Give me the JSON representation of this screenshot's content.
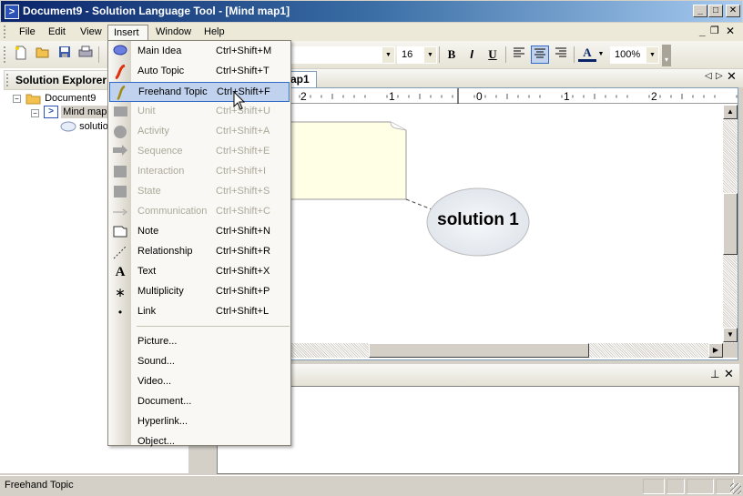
{
  "window": {
    "title": "Document9 - Solution Language Tool - [Mind map1]",
    "app_icon": "app-logo-icon",
    "controls": {
      "minimize": "_",
      "maximize": "□",
      "close": "✕"
    },
    "mdi_controls": {
      "minimize": "_",
      "restore": "🗗",
      "close": "✕"
    }
  },
  "menubar": {
    "items": [
      {
        "label": "File",
        "accel": "F"
      },
      {
        "label": "Edit",
        "accel": "E"
      },
      {
        "label": "View",
        "accel": "V"
      },
      {
        "label": "Insert",
        "accel": "I",
        "open": true
      },
      {
        "label": "Window",
        "accel": "W"
      },
      {
        "label": "Help",
        "accel": "H"
      }
    ]
  },
  "toolbar": {
    "buttons": [
      "new-icon",
      "open-icon",
      "save-icon",
      "print-icon"
    ],
    "font_name": "",
    "font_size": "16",
    "bold": "B",
    "italic": "I",
    "underline": "U",
    "align": [
      "left",
      "center",
      "right"
    ],
    "align_active": "center",
    "font_color_label": "A",
    "zoom": "100%"
  },
  "solution_explorer": {
    "title": "Solution Explorer",
    "tree": [
      {
        "label": "Document9",
        "icon": "folder-icon",
        "level": 0,
        "expanded": true
      },
      {
        "label": "Mind map1",
        "icon": "mindmap-icon",
        "level": 1,
        "expanded": true,
        "selected": true
      },
      {
        "label": "solution 1",
        "icon": "ellipse-icon",
        "level": 2
      }
    ]
  },
  "document": {
    "tab_label": "Mind map1",
    "tab_visible_text": "ap1",
    "ruler_labels": [
      "2",
      "1",
      "0",
      "1",
      "2"
    ],
    "canvas": {
      "note_fill": "#ffffe6",
      "node": {
        "label": "solution 1"
      }
    }
  },
  "insert_menu": {
    "items": [
      {
        "label": "Main Idea",
        "shortcut": "Ctrl+Shift+M",
        "icon": "ellipse-icon",
        "enabled": true
      },
      {
        "label": "Auto Topic",
        "shortcut": "Ctrl+Shift+T",
        "icon": "auto-topic-icon",
        "enabled": true
      },
      {
        "label": "Freehand Topic",
        "shortcut": "Ctrl+Shift+F",
        "icon": "freehand-topic-icon",
        "enabled": true,
        "highlighted": true
      },
      {
        "label": "Unit",
        "shortcut": "Ctrl+Shift+U",
        "icon": "unit-icon",
        "enabled": false
      },
      {
        "label": "Activity",
        "shortcut": "Ctrl+Shift+A",
        "icon": "activity-icon",
        "enabled": false
      },
      {
        "label": "Sequence",
        "shortcut": "Ctrl+Shift+E",
        "icon": "sequence-icon",
        "enabled": false
      },
      {
        "label": "Interaction",
        "shortcut": "Ctrl+Shift+I",
        "icon": "interaction-icon",
        "enabled": false
      },
      {
        "label": "State",
        "shortcut": "Ctrl+Shift+S",
        "icon": "state-icon",
        "enabled": false
      },
      {
        "label": "Communication",
        "shortcut": "Ctrl+Shift+C",
        "icon": "communication-icon",
        "enabled": false
      },
      {
        "label": "Note",
        "shortcut": "Ctrl+Shift+N",
        "icon": "note-icon",
        "enabled": true
      },
      {
        "label": "Relationship",
        "shortcut": "Ctrl+Shift+R",
        "icon": "relationship-icon",
        "enabled": true
      },
      {
        "label": "Text",
        "shortcut": "Ctrl+Shift+X",
        "icon": "text-icon",
        "enabled": true
      },
      {
        "label": "Multiplicity",
        "shortcut": "Ctrl+Shift+P",
        "icon": "multiplicity-icon",
        "enabled": true
      },
      {
        "label": "Link",
        "shortcut": "Ctrl+Shift+L",
        "icon": "link-icon",
        "enabled": true
      }
    ],
    "media_items": [
      {
        "label": "Picture..."
      },
      {
        "label": "Sound..."
      },
      {
        "label": "Video..."
      },
      {
        "label": "Document..."
      },
      {
        "label": "Hyperlink..."
      },
      {
        "label": "Object..."
      }
    ]
  },
  "bottom_panel": {
    "pin": "📌",
    "close": "✕"
  },
  "statusbar": {
    "text": "Freehand Topic"
  }
}
